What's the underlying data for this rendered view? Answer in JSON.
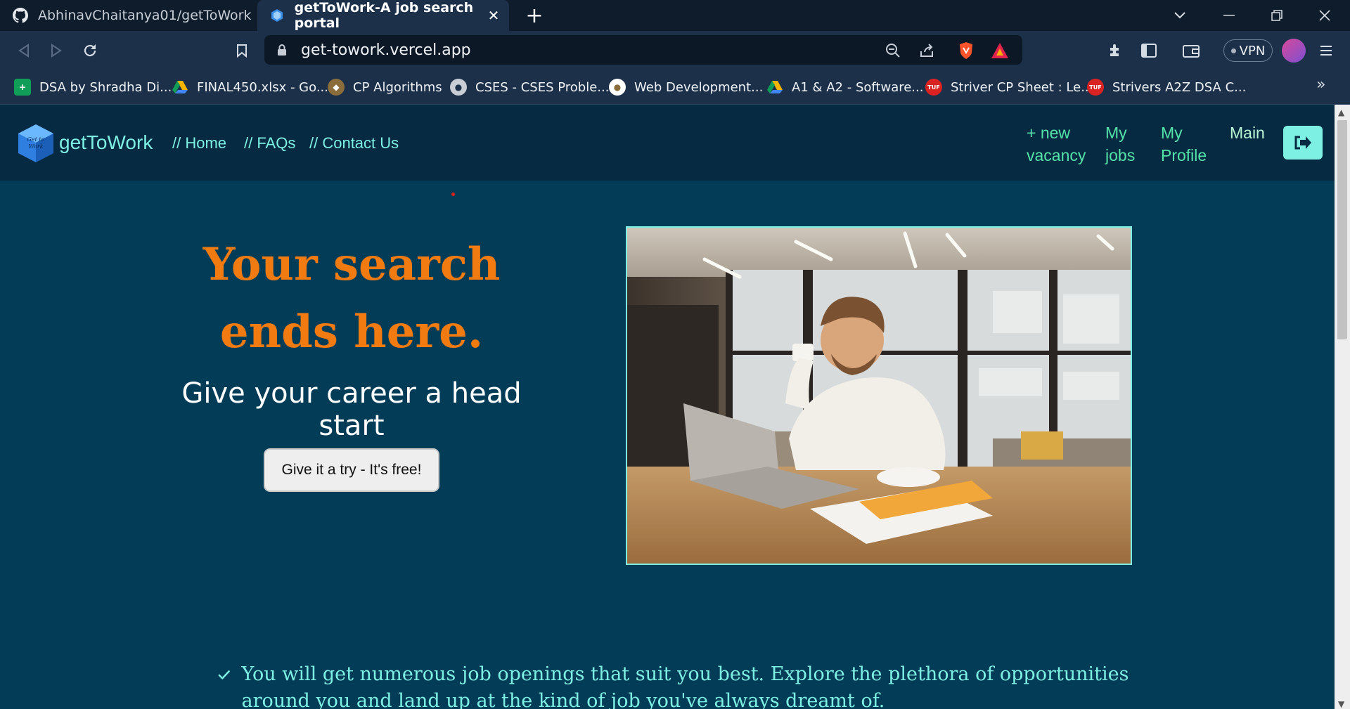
{
  "browser": {
    "tabs": [
      {
        "title": "AbhinavChaitanya01/getToWork",
        "icon": "github-icon"
      },
      {
        "title": "getToWork-A job search portal",
        "icon": "gettowork-favicon",
        "active": true
      }
    ],
    "url": "get-towork.vercel.app",
    "vpn_label": "VPN",
    "bookmarks": [
      {
        "label": "DSA by Shradha Di...",
        "icon": "sheets-icon",
        "color": "#0f9d58"
      },
      {
        "label": "FINAL450.xlsx - Go...",
        "icon": "drive-icon",
        "color": "#f4b400"
      },
      {
        "label": "CP Algorithms",
        "icon": "cp-algorithms-icon",
        "color": "#8a6d3b"
      },
      {
        "label": "CSES - CSES Proble...",
        "icon": "globe-icon",
        "color": "#c9ced6"
      },
      {
        "label": "Web Development...",
        "icon": "web-dev-icon",
        "color": "#ffffff"
      },
      {
        "label": "A1 & A2 - Software...",
        "icon": "drive-icon",
        "color": "#f4b400"
      },
      {
        "label": "Striver CP Sheet : Le...",
        "icon": "tuf-icon",
        "color": "#d92222"
      },
      {
        "label": "Strivers A2Z DSA C...",
        "icon": "tuf-icon",
        "color": "#d92222"
      }
    ]
  },
  "site": {
    "brand": "getToWork",
    "logo_text": "Get to Work",
    "nav_left": [
      "// Home",
      "// FAQs",
      "// Contact Us"
    ],
    "nav_right": {
      "new_vacancy": [
        "+ new",
        "vacancy"
      ],
      "my_jobs": [
        "My",
        "jobs"
      ],
      "my_profile": [
        "My",
        "Profile"
      ],
      "main": "Main"
    },
    "colors": {
      "accent": "#7ef0e3",
      "title": "#f27b11",
      "bg": "#023c57",
      "nav_bg": "#062a42"
    }
  },
  "hero": {
    "title": "Your search ends here.",
    "subtitle": "Give your career a head start",
    "cta_label": "Give it a try - It's free!"
  },
  "features": [
    {
      "text": "You will get numerous job openings that suit you best. Explore the plethora of opportunities around you and land up at the kind of job you've always dreamt of."
    }
  ]
}
